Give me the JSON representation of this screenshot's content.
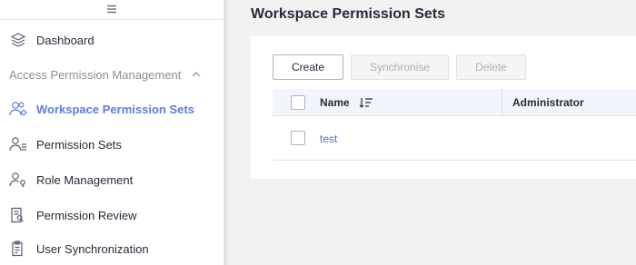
{
  "sidebar": {
    "toggle_icon": "menu-icon",
    "items": [
      {
        "label": "Dashboard",
        "icon": "layers-icon"
      },
      {
        "label": "Workspace Permission Sets",
        "icon": "users-gear-icon",
        "active": true
      },
      {
        "label": "Permission Sets",
        "icon": "user-list-icon"
      },
      {
        "label": "Role Management",
        "icon": "user-key-icon"
      },
      {
        "label": "Permission Review",
        "icon": "document-search-icon"
      },
      {
        "label": "User Synchronization",
        "icon": "clipboard-sync-icon"
      }
    ],
    "group": {
      "label": "Access Permission Management",
      "expanded": true
    }
  },
  "main": {
    "title": "Workspace Permission Sets",
    "toolbar": {
      "create_label": "Create",
      "synchronise_label": "Synchronise",
      "delete_label": "Delete"
    },
    "table": {
      "columns": [
        "Name",
        "Administrator"
      ],
      "rows": [
        {
          "name": "test",
          "administrator": ""
        }
      ]
    }
  },
  "colors": {
    "accent": "#5e7ce0",
    "link": "#526ecc",
    "text": "#252b3a",
    "muted": "#8a8e99",
    "header_bg": "#f2f5fc"
  }
}
